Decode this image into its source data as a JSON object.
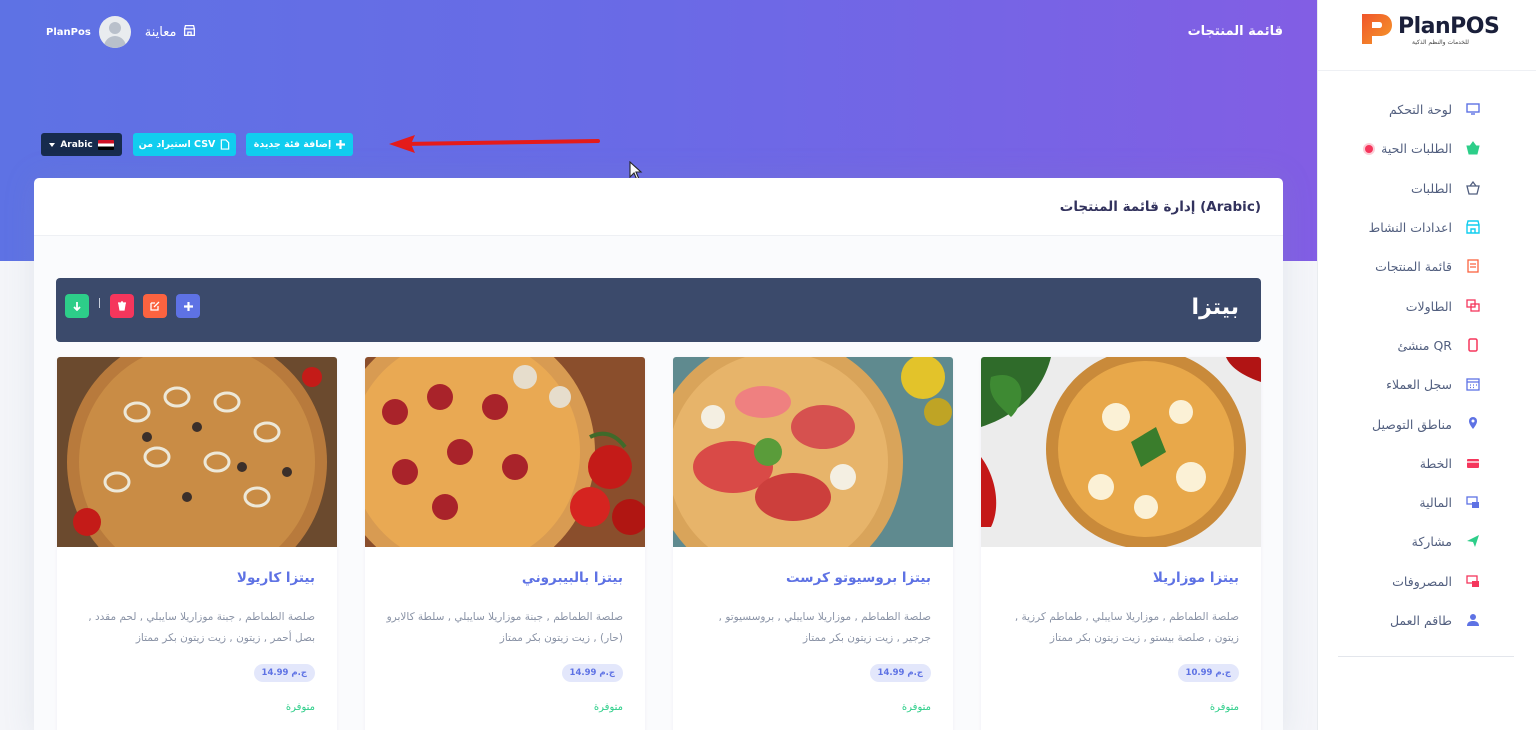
{
  "app": {
    "brand": "PlanPOS",
    "brand_tagline": "للخدمات والنظم الذكية"
  },
  "header": {
    "page_heading": "قائمة المنتجات",
    "preview_label": "معاينة",
    "user_name": "PlanPos"
  },
  "sidebar": {
    "items": [
      {
        "label": "لوحة التحكم",
        "icon": "monitor-icon",
        "color": "#5e72e4"
      },
      {
        "label": "الطلبات الحية",
        "icon": "basket-icon",
        "color": "#2dce89",
        "live": true
      },
      {
        "label": "الطلبات",
        "icon": "basket-icon",
        "color": "#525f7f"
      },
      {
        "label": "اعدادات النشاط",
        "icon": "store-icon",
        "color": "#11cdef"
      },
      {
        "label": "قائمة المنتجات",
        "icon": "menu-list-icon",
        "color": "#fb6340"
      },
      {
        "label": "الطاولات",
        "icon": "tables-icon",
        "color": "#f5365c"
      },
      {
        "label": "منشئ QR",
        "icon": "mobile-icon",
        "color": "#f5365c"
      },
      {
        "label": "سجل العملاء",
        "icon": "calendar-icon",
        "color": "#5e72e4"
      },
      {
        "label": "مناطق التوصيل",
        "icon": "map-pin-icon",
        "color": "#5e72e4"
      },
      {
        "label": "الخطة",
        "icon": "credit-card-icon",
        "color": "#f5365c"
      },
      {
        "label": "المالية",
        "icon": "finance-icon",
        "color": "#5e72e4"
      },
      {
        "label": "مشاركة",
        "icon": "send-icon",
        "color": "#2dce89"
      },
      {
        "label": "المصروفات",
        "icon": "expenses-icon",
        "color": "#f5365c"
      },
      {
        "label": "طاقم العمل",
        "icon": "user-icon",
        "color": "#5e72e4"
      }
    ]
  },
  "actions": {
    "language_label": "Arabic",
    "import_csv_label": "استيراد من CSV",
    "add_category_label": "إضافة فئة جديدة"
  },
  "card": {
    "title": "إدارة قائمة المنتجات (Arabic)"
  },
  "category": {
    "name": "بيتزا"
  },
  "products": [
    {
      "name": "بيتزا موزاريلا",
      "description": "صلصة الطماطم , موزاريلا سايبلي , طماطم كرزية , زيتون , صلصة بيستو , زيت زيتون بكر ممتاز",
      "price": "10.99 ج.م",
      "status": "متوفرة"
    },
    {
      "name": "بيتزا بروسيوتو كرست",
      "description": "صلصة الطماطم , موزاريلا سايبلي , بروسسيوتو , جرجير , زيت زيتون بكر ممتاز",
      "price": "14.99 ج.م",
      "status": "متوفرة"
    },
    {
      "name": "بيتزا بالبيبروني",
      "description": "صلصة الطماطم , جبنة موزاريلا سايبلي , سلطة كالابرو (حار) , زيت زيتون بكر ممتاز",
      "price": "14.99 ج.م",
      "status": "متوفرة"
    },
    {
      "name": "بيتزا كاريولا",
      "description": "صلصة الطماطم , جبنة موزاريلا سايبلي , لحم مقدد , بصل أحمر , زيتون , زيت زيتون بكر ممتاز",
      "price": "14.99 ج.م",
      "status": "متوفرة"
    }
  ],
  "colors": {
    "primary": "#5e72e4",
    "gradient_end": "#825ee4",
    "info": "#11cdef",
    "dark": "#172b4d",
    "category_bar": "#3b4a6b",
    "success": "#2dce89",
    "danger": "#f5365c",
    "warning": "#fb6340"
  }
}
